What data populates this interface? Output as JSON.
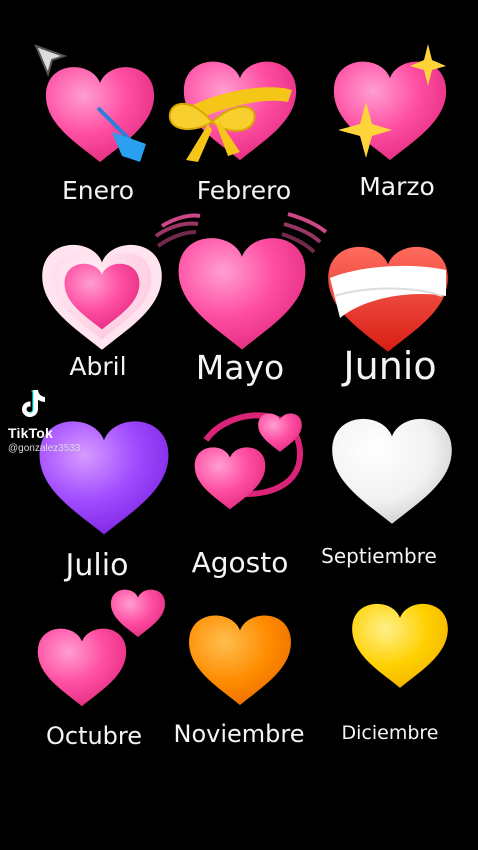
{
  "months": [
    {
      "id": "enero",
      "label": "Enero",
      "heart": "pink-heart-with-arrow"
    },
    {
      "id": "febrero",
      "label": "Febrero",
      "heart": "heart-with-ribbon"
    },
    {
      "id": "marzo",
      "label": "Marzo",
      "heart": "sparkling-heart"
    },
    {
      "id": "abril",
      "label": "Abril",
      "heart": "growing-heart"
    },
    {
      "id": "mayo",
      "label": "Mayo",
      "heart": "beating-heart"
    },
    {
      "id": "junio",
      "label": "Junio",
      "heart": "mending-heart"
    },
    {
      "id": "julio",
      "label": "Julio",
      "heart": "purple-heart"
    },
    {
      "id": "agosto",
      "label": "Agosto",
      "heart": "revolving-hearts"
    },
    {
      "id": "septiembre",
      "label": "Septiembre",
      "heart": "white-heart"
    },
    {
      "id": "octubre",
      "label": "Octubre",
      "heart": "two-hearts"
    },
    {
      "id": "noviembre",
      "label": "Noviembre",
      "heart": "orange-heart"
    },
    {
      "id": "diciembre",
      "label": "Diciembre",
      "heart": "yellow-heart"
    }
  ],
  "watermark": {
    "brand": "TikTok",
    "user": "@gonzalez3533",
    "icon": "tiktok-logo-icon"
  },
  "cursor": {
    "icon": "mouse-pointer-icon"
  },
  "colors": {
    "background": "#000000",
    "pink": "#ff4fa3",
    "purple": "#a14cff",
    "orange": "#ff8c00",
    "yellow": "#ffd000",
    "white": "#f2f2f2",
    "ribbon": "#f5c518",
    "red": "#e8291f"
  }
}
